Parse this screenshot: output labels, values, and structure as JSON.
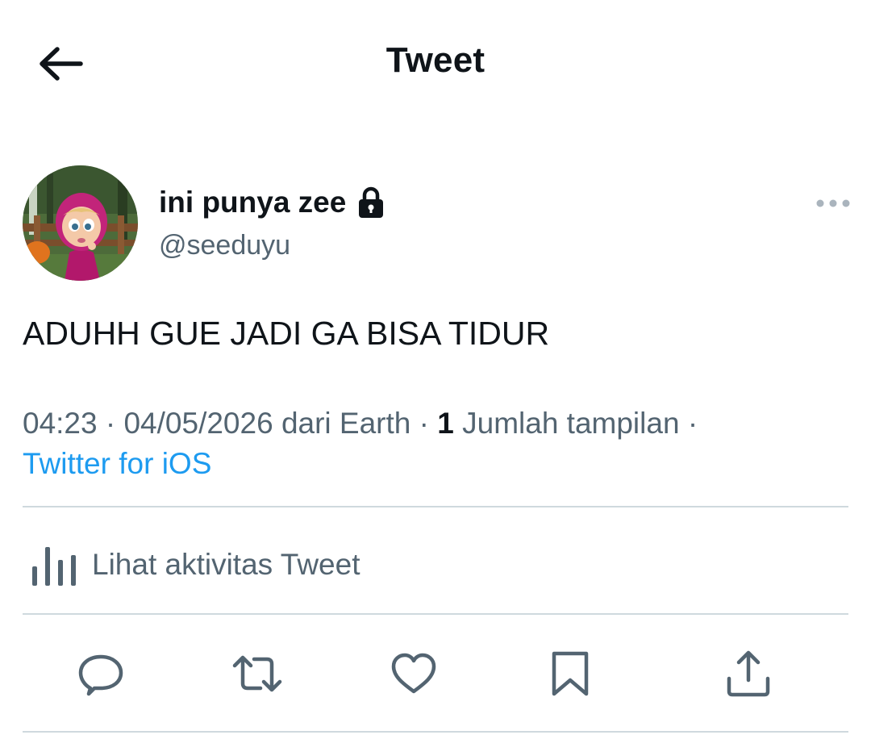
{
  "header": {
    "title": "Tweet"
  },
  "author": {
    "name": "ini punya zee",
    "handle": "@seeduyu"
  },
  "tweet": {
    "text": "ADUHH GUE JADI GA BISA TIDUR"
  },
  "meta": {
    "time": "04:23",
    "date": "04/05/2026",
    "location": "dari Earth",
    "views_count": "1",
    "views_label": "Jumlah tampilan",
    "separator": "·",
    "source": "Twitter for iOS"
  },
  "activity": {
    "label": "Lihat aktivitas Tweet"
  },
  "actions": [
    "reply-icon",
    "retweet-icon",
    "like-icon",
    "bookmark-icon",
    "share-icon"
  ],
  "colors": {
    "text": "#0f1419",
    "secondary": "#536471",
    "link": "#1d9bf0",
    "divider": "#cfd9de"
  }
}
